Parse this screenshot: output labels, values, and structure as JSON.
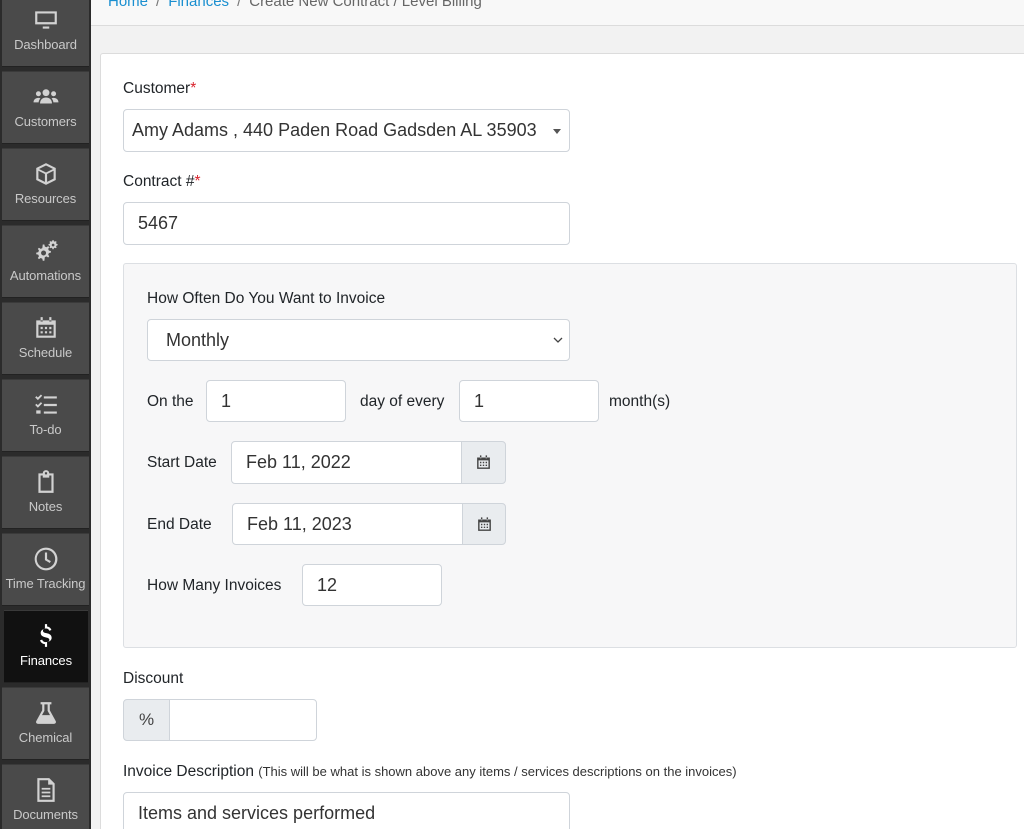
{
  "sidebar": {
    "items": [
      {
        "label": "Dashboard",
        "icon": "monitor-icon"
      },
      {
        "label": "Customers",
        "icon": "users-icon"
      },
      {
        "label": "Resources",
        "icon": "box-icon"
      },
      {
        "label": "Automations",
        "icon": "gears-icon"
      },
      {
        "label": "Schedule",
        "icon": "calendar-icon"
      },
      {
        "label": "To-do",
        "icon": "checklist-icon"
      },
      {
        "label": "Notes",
        "icon": "clipboard-icon"
      },
      {
        "label": "Time Tracking",
        "icon": "clock-icon"
      },
      {
        "label": "Finances",
        "icon": "dollar-icon"
      },
      {
        "label": "Chemical",
        "icon": "flask-icon"
      },
      {
        "label": "Documents",
        "icon": "document-icon"
      }
    ],
    "active": "Finances"
  },
  "breadcrumb": {
    "home": "Home",
    "finances": "Finances",
    "current": "Create New Contract / Level Billing",
    "separator": "/"
  },
  "form": {
    "customer_label": "Customer",
    "required_mark": "*",
    "customer_value": "Amy Adams , 440 Paden Road Gadsden AL 35903",
    "contract_label": "Contract #",
    "contract_value": "5467",
    "frequency_label": "How Often Do You Want to Invoice",
    "frequency_value": "Monthly",
    "on_the_label": "On the",
    "day_value": "1",
    "day_of_every_label": "day of every",
    "month_value": "1",
    "months_label": "month(s)",
    "start_date_label": "Start Date",
    "start_date_value": "Feb 11, 2022",
    "end_date_label": "End Date",
    "end_date_value": "Feb 11, 2023",
    "invoices_label": "How Many Invoices",
    "invoices_value": "12",
    "discount_label": "Discount",
    "discount_addon": "%",
    "discount_value": "",
    "invoice_desc_label": "Invoice Description",
    "invoice_desc_hint": "(This will be what is shown above any items / services descriptions on the invoices)",
    "invoice_desc_value": "Items and services performed"
  },
  "colors": {
    "sidebar_bg": "#2b2b2b",
    "nav_item_bg": "#4a4a4a",
    "nav_active_bg": "#111111",
    "link": "#1a8fd0",
    "required": "#d9232d"
  }
}
